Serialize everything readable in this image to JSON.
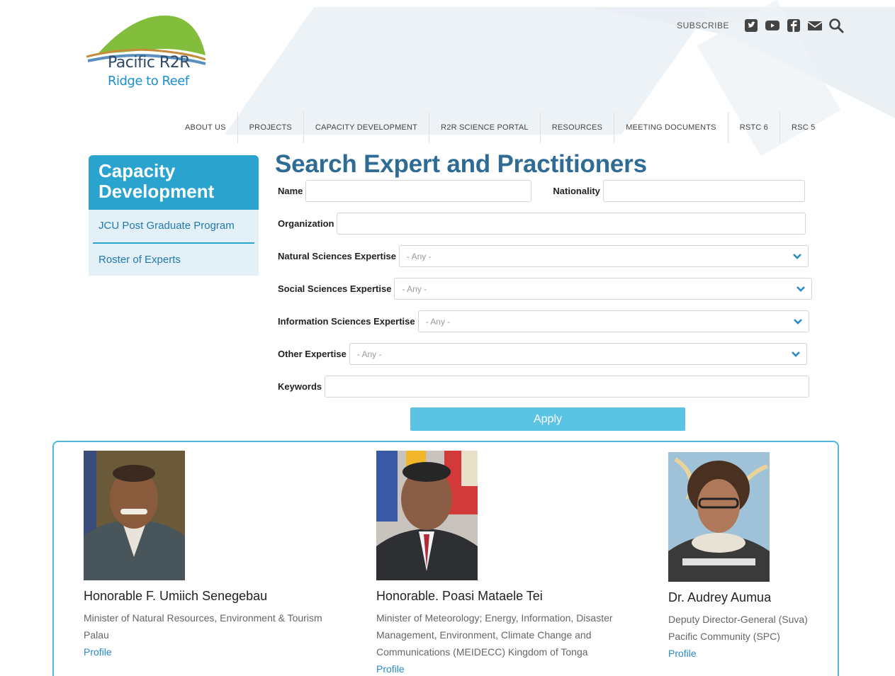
{
  "brand": {
    "logo_line1": "Pacific R2R",
    "logo_line2": "Ridge to Reef"
  },
  "topbar": {
    "subscribe": "SUBSCRIBE",
    "icons": [
      "twitter-icon",
      "youtube-icon",
      "facebook-icon",
      "mail-icon",
      "search-icon"
    ]
  },
  "nav": {
    "items": [
      "ABOUT US",
      "PROJECTS",
      "CAPACITY DEVELOPMENT",
      "R2R SCIENCE PORTAL",
      "RESOURCES",
      "MEETING DOCUMENTS",
      "RSTC 6",
      "RSC 5"
    ]
  },
  "sidebar": {
    "title": "Capacity Development",
    "links": [
      "JCU Post Graduate Program",
      "Roster of Experts"
    ]
  },
  "page": {
    "title": "Search Expert and Practitioners"
  },
  "form": {
    "name_label": "Name",
    "nationality_label": "Nationality",
    "organization_label": "Organization",
    "natural_label": "Natural Sciences Expertise",
    "social_label": "Social Sciences Expertise",
    "information_label": "Information Sciences Expertise",
    "other_label": "Other Expertise",
    "keywords_label": "Keywords",
    "any_option": "- Any -",
    "apply_label": "Apply"
  },
  "experts": [
    {
      "name": "Honorable F. Umiich Senegebau",
      "role_lines": [
        "Minister of Natural Resources, Environment & Tourism",
        "Palau"
      ],
      "profile": "Profile"
    },
    {
      "name": "Honorable. Poasi Mataele Tei",
      "role_lines": [
        "Minister of Meteorology; Energy, Information, Disaster",
        "Management, Environment, Climate Change and",
        "Communications (MEIDECC) Kingdom of Tonga"
      ],
      "profile": "Profile"
    },
    {
      "name": "Dr. Audrey Aumua",
      "role_lines": [
        "Deputy Director-General (Suva)",
        "Pacific Community (SPC)"
      ],
      "profile": "Profile"
    }
  ],
  "colors": {
    "accent": "#2aa3cf",
    "title": "#2e6c95",
    "button": "#5bc4e5",
    "link": "#2079b0"
  }
}
